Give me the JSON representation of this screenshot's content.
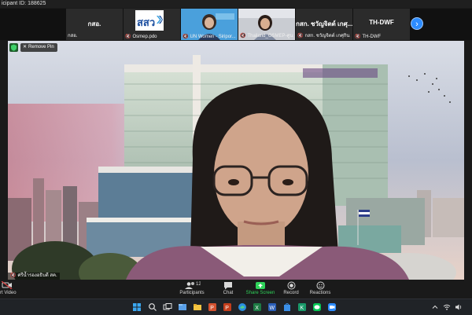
{
  "window": {
    "title": "icipant ID: 188625"
  },
  "gallery": {
    "tiles": [
      {
        "name": "กสอ.",
        "label": "กสอ."
      },
      {
        "name": "",
        "label": "Osmep.pdo",
        "logo_text": "สสว"
      },
      {
        "name": "",
        "label": "UN Women - Siripor..."
      },
      {
        "name": "",
        "label": "Thailand_OSMEP-ศูนย..."
      },
      {
        "name": "กสก. ชวัญจิตต์ เกศุ...",
        "label": "กสก. ชวัญจิตต์ เกศุกิน"
      },
      {
        "name": "TH-DWF",
        "label": "TH-DWF"
      }
    ],
    "next_icon": "chevron-right-icon",
    "next_glyph": "›"
  },
  "main_video": {
    "remove_pin_label": "Remove Pin",
    "speaker_label": "ศรีน้ำรองอธิบดี สค."
  },
  "toolbar": {
    "start_video_label": "rt Video",
    "participants_label": "Participants",
    "participants_count": "12",
    "chat_label": "Chat",
    "share_screen_label": "Share Screen",
    "record_label": "Record",
    "reactions_label": "Reactions"
  },
  "taskbar": {
    "icons": [
      "windows-start-icon",
      "search-icon",
      "task-view-icon",
      "file-explorer-icon",
      "folder-icon",
      "powerpoint-icon",
      "edge-icon",
      "excel-icon",
      "word-icon",
      "store-icon",
      "k-app-icon",
      "line-icon",
      "zoom-icon"
    ],
    "tray_icons": [
      "chevron-up-icon",
      "wifi-icon",
      "volume-icon"
    ]
  },
  "colors": {
    "accent": "#2d8cff",
    "mic_off": "#e64646",
    "share_green": "#2fd35a",
    "toolbar_bg": "#1a1a1a"
  }
}
